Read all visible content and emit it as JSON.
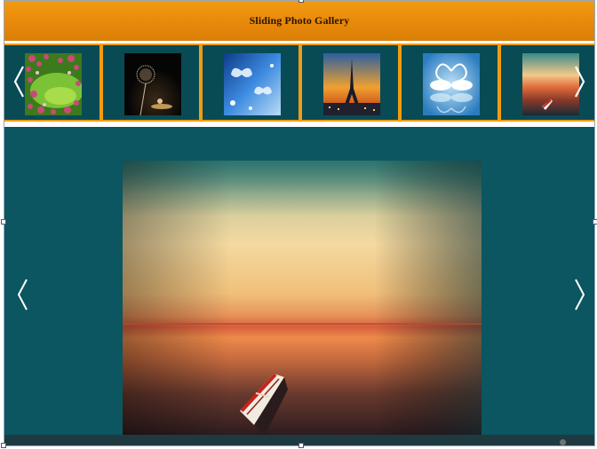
{
  "header": {
    "title": "Sliding Photo Gallery"
  },
  "thumbnails": [
    {
      "name": "pink-flowers",
      "colors": [
        "#2c5a16",
        "#66a82c",
        "#c94a7a"
      ]
    },
    {
      "name": "dandelion-sunset",
      "colors": [
        "#0a0a0a",
        "#1a1510",
        "#d6b07a"
      ]
    },
    {
      "name": "blue-butterflies",
      "colors": [
        "#1d5fc0",
        "#6fb2ea",
        "#e8f4ff"
      ]
    },
    {
      "name": "eiffel-tower-sunset",
      "colors": [
        "#f0a030",
        "#3060a0",
        "#1a1a3a"
      ]
    },
    {
      "name": "swans-heart",
      "colors": [
        "#2f86c8",
        "#bfe2f6",
        "#ffffff"
      ]
    },
    {
      "name": "boat-sunset-thumb",
      "colors": [
        "#f3c98a",
        "#e06a3a",
        "#1a2a34"
      ]
    }
  ],
  "main_photo": {
    "name": "boat-on-sunset-lake",
    "sky_top": "#1f6b6a",
    "sky_mid": "#f2c98a",
    "horizon": "#e8573a",
    "water": "#3a1a1a"
  },
  "colors": {
    "accent": "#f39c12",
    "stage": "#0b5660",
    "cell": "#084b55"
  }
}
